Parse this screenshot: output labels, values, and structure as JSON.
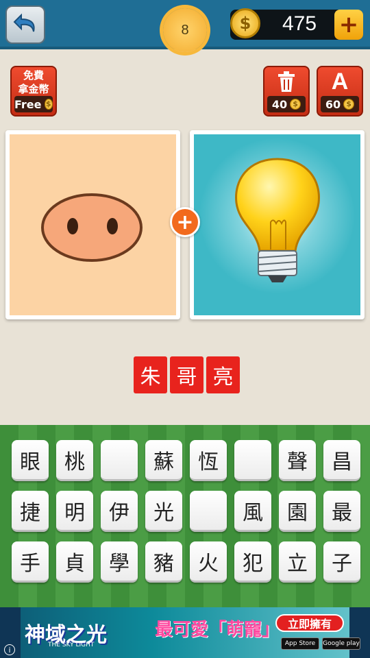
{
  "header": {
    "level": "8",
    "coins": "475",
    "coin_symbol": "$",
    "plus_label": "+"
  },
  "powerups": {
    "free": {
      "line1": "免費",
      "line2": "拿金幣",
      "label": "Free",
      "coin_symbol": "$"
    },
    "remove_letter": {
      "cost": "40",
      "coin_symbol": "$",
      "icon": "trash-icon"
    },
    "reveal_letter": {
      "icon_text": "A",
      "cost": "60",
      "coin_symbol": "$"
    }
  },
  "puzzle": {
    "left_image": "pig-nose",
    "right_image": "light-bulb",
    "combine_symbol": "+"
  },
  "answer": [
    "朱",
    "哥",
    "亮"
  ],
  "keyboard": {
    "rows": [
      [
        "眼",
        "桃",
        "",
        "蘇",
        "恆",
        "",
        "聲",
        "昌"
      ],
      [
        "捷",
        "明",
        "伊",
        "光",
        "",
        "風",
        "園",
        "最"
      ],
      [
        "手",
        "貞",
        "學",
        "豬",
        "火",
        "犯",
        "立",
        "子"
      ]
    ]
  },
  "ad": {
    "title": "神域之光",
    "subtitle": "THE SKY LIGHT",
    "slogan": "最可愛「萌寵」",
    "cta": "立即擁有",
    "store_apple": "App Store",
    "store_google": "Google play",
    "info": "i"
  }
}
